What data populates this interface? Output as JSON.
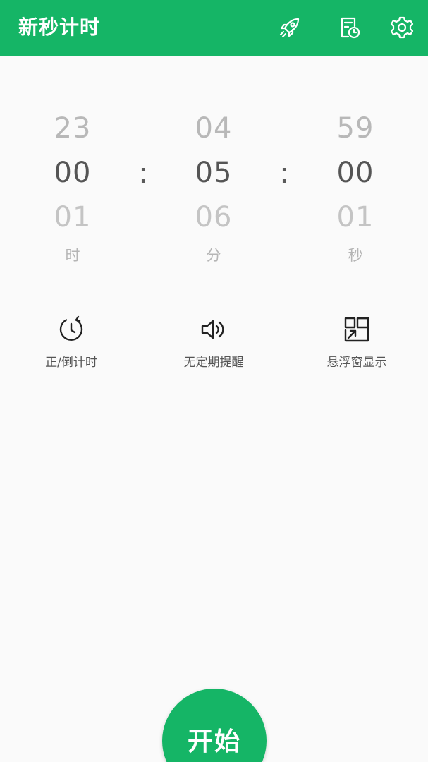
{
  "app": {
    "title": "新秒计时",
    "colors": {
      "primary": "#15b566",
      "background": "#fafafa"
    }
  },
  "toolbar": {
    "icons": [
      "rocket-icon",
      "timer-record-icon",
      "gear-icon"
    ]
  },
  "picker": {
    "hours": {
      "prev": "23",
      "current": "00",
      "next": "01",
      "unit": "时"
    },
    "minutes": {
      "prev": "04",
      "current": "05",
      "next": "06",
      "unit": "分"
    },
    "seconds": {
      "prev": "59",
      "current": "00",
      "next": "01",
      "unit": "秒"
    },
    "separator": ":"
  },
  "options": [
    {
      "label": "正/倒计时",
      "icon": "countdown-icon"
    },
    {
      "label": "无定期提醒",
      "icon": "speaker-icon"
    },
    {
      "label": "悬浮窗显示",
      "icon": "floating-window-icon"
    }
  ],
  "start_button": {
    "label": "开始"
  }
}
